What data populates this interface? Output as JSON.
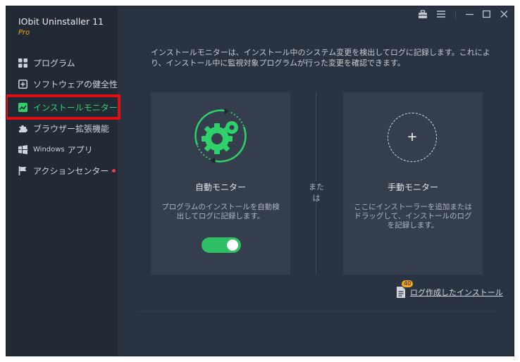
{
  "app": {
    "title": "IObit Uninstaller 11",
    "edition": "Pro"
  },
  "sidebar": {
    "items": [
      {
        "label": "プログラム",
        "icon": "grid-icon"
      },
      {
        "label": "ソフトウェアの健全性",
        "icon": "plus-square-icon"
      },
      {
        "label": "インストールモニター",
        "icon": "chart-icon",
        "active": true
      },
      {
        "label": "ブラウザー拡張機能",
        "icon": "puzzle-icon"
      },
      {
        "label": "Windows",
        "label2": "アプリ",
        "icon": "windows-icon"
      },
      {
        "label": "アクションセンター",
        "icon": "flag-icon",
        "notification_dot": true
      }
    ]
  },
  "titlebar": {
    "buttons": [
      "toolbox-icon",
      "menu-icon",
      "minimize-icon",
      "maximize-icon",
      "close-icon"
    ]
  },
  "main": {
    "description": "インストールモニターは、インストール中のシステム変更を検出してログに記録します。これにより、インストール中に監視対象プログラムが行った変更を確認できます。",
    "auto_card": {
      "title": "自動モニター",
      "desc": "プログラムのインストールを自動検出してログに記録します。",
      "toggle_on": true
    },
    "or_label": "または",
    "manual_card": {
      "title": "手動モニター",
      "desc": "ここにインストーラーを追加またはドラッグして、インストールのログを記録します。"
    },
    "logs": {
      "badge": "40",
      "label": "ログ作成したインストール"
    }
  },
  "colors": {
    "accent": "#2fd26a",
    "highlight": "#e01010",
    "badge": "#f2a81d",
    "background": "#2a3341",
    "sidebar": "#222a35"
  }
}
